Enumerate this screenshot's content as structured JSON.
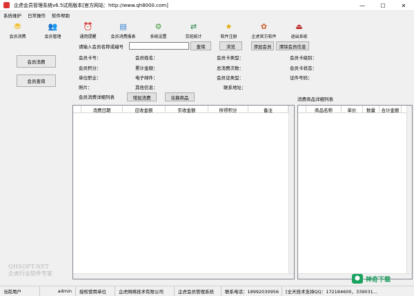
{
  "window": {
    "title": "企虎会员管理系统v6.5试用版本[官方网站：http://www.qh8000.com]",
    "minimize": "—",
    "maximize": "☐",
    "close": "✕"
  },
  "menu": [
    "系统维护",
    "日常操作",
    "软件帮助"
  ],
  "toolbar": [
    {
      "label": "会员消费",
      "icon": "coin-icon",
      "glyph": "⛃",
      "color": "#f0b400"
    },
    {
      "label": "会员管理",
      "icon": "users-icon",
      "glyph": "👥",
      "color": "#4a7fd6"
    },
    {
      "label": "通用提醒",
      "icon": "alarm-clock-icon",
      "glyph": "⏰",
      "color": "#333333"
    },
    {
      "label": "会员消费报表",
      "icon": "report-icon",
      "glyph": "▤",
      "color": "#2f7fd0"
    },
    {
      "label": "系统设置",
      "icon": "settings-icon",
      "glyph": "⚙",
      "color": "#3a9a3a"
    },
    {
      "label": "交班统计",
      "icon": "handover-icon",
      "glyph": "⇄",
      "color": "#1e7b3c"
    },
    {
      "label": "软件注册",
      "icon": "register-star-icon",
      "glyph": "★",
      "color": "#e2a500"
    },
    {
      "label": "企虎官方软件",
      "icon": "official-software-icon",
      "glyph": "✿",
      "color": "#d05a2a"
    },
    {
      "label": "退出系统",
      "icon": "exit-icon",
      "glyph": "⏏",
      "color": "#c02020"
    }
  ],
  "sidebar": {
    "consume_button": "会员消费",
    "query_button": "会员查询",
    "watermark_line1": "QHSOFT.NET",
    "watermark_line2": "企虎行业软件专家"
  },
  "search": {
    "label": "请输入会员名称或编号",
    "value": "",
    "query_button": "查询",
    "browse_button": "浏览",
    "add_button": "添加会员",
    "clear_button": "清除会员信息"
  },
  "member_fields": {
    "card_no": "会员卡号：",
    "name": "会员姓名：",
    "card_type": "会员卡类型：",
    "card_level": "会员卡级别：",
    "points": "会员积分：",
    "total_amount": "累计金额：",
    "total_times": "总消费次数：",
    "card_status": "会员卡状态：",
    "work_unit": "单位职业：",
    "email": "电子邮件：",
    "id_type": "会员证类型：",
    "id_number": "证件号码：",
    "photo": "照片：",
    "other_info": "其他信息：",
    "address": "联系地址："
  },
  "consume_section": {
    "label": "会员消费详细列表",
    "add_consume_button": "增加消费",
    "redeem_button": "兑换商品",
    "columns": [
      "消费日期",
      "应收金额",
      "实收金额",
      "所得积分",
      "备注"
    ]
  },
  "goods_section": {
    "label": "消费商品详细列表",
    "columns": [
      "商品名称",
      "单价",
      "数量",
      "合计金额"
    ]
  },
  "statusbar": {
    "current_user_label": "当前用户",
    "current_user": "admin",
    "licensee_label": "授权使用单位",
    "licensee": "企虎网络技术有限公司",
    "product": "企虎会员管理系统",
    "phone": "联系电话：18992030956",
    "support": "[全天技术支持QQ：172184600，339031..."
  },
  "site_logo": {
    "mark": "⬢",
    "text": "神奇下载"
  }
}
